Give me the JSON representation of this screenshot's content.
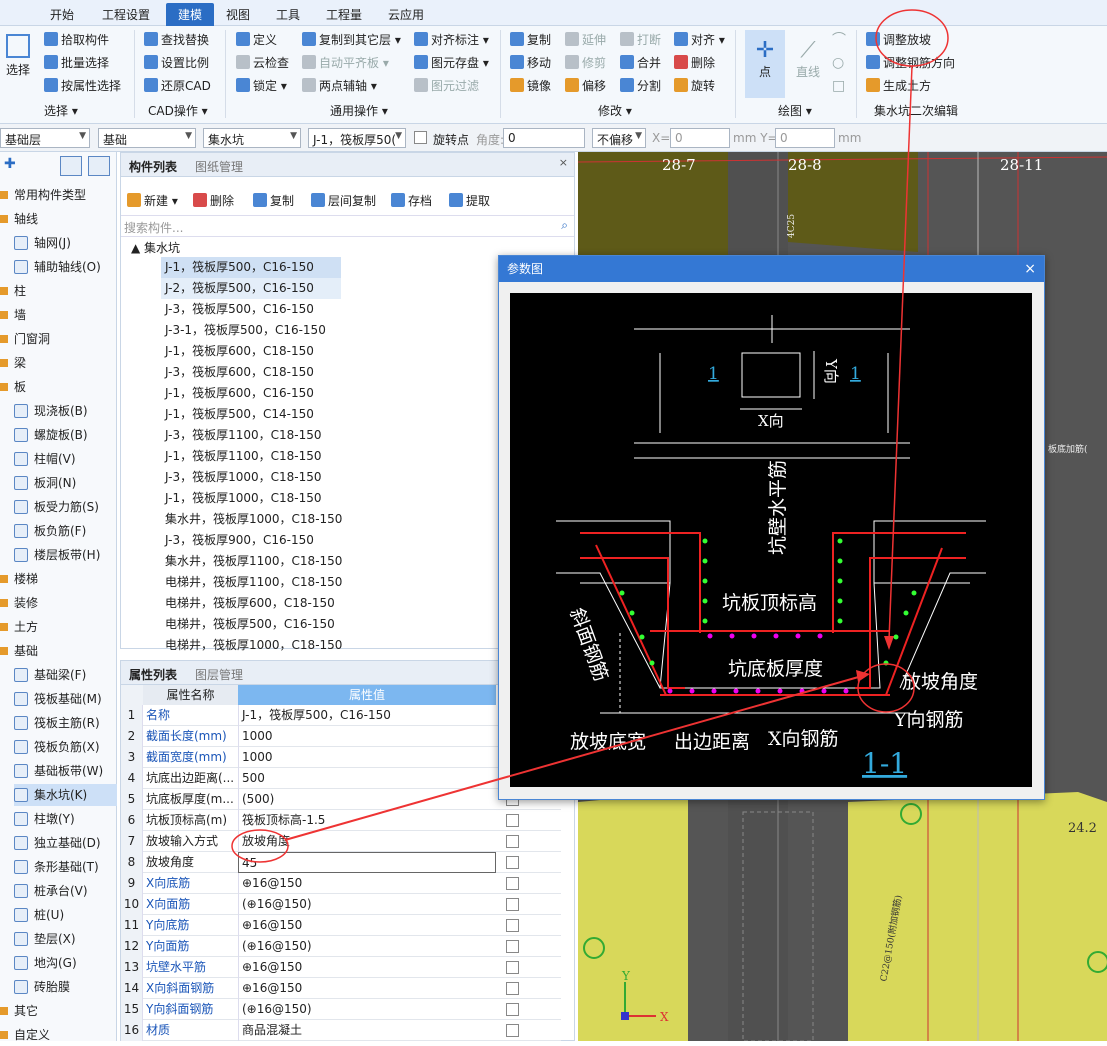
{
  "ribbon_tabs": [
    "开始",
    "工程设置",
    "建模",
    "视图",
    "工具",
    "工程量",
    "云应用"
  ],
  "select_group": {
    "select": "选择",
    "pick": "拾取构件",
    "batch": "批量选择",
    "by_prop": "按属性选择",
    "label": "选择 ▾"
  },
  "cad_group": {
    "find": "查找替换",
    "scale": "设置比例",
    "restore": "还原CAD",
    "label": "CAD操作 ▾"
  },
  "common_group": {
    "define": "定义",
    "cloud": "云检查",
    "lock": "锁定 ▾",
    "copy_to": "复制到其它层 ▾",
    "auto_level": "自动平齐板 ▾",
    "two_point": "两点辅轴 ▾",
    "align_label": "对齐标注 ▾",
    "elem_store": "图元存盘 ▾",
    "elem_filter": "图元过滤",
    "label": "通用操作 ▾"
  },
  "modify_group": {
    "copy": "复制",
    "move": "移动",
    "mirror": "镜像",
    "extend": "延伸",
    "trim": "修剪",
    "offset": "偏移",
    "break": "打断",
    "merge": "合并",
    "split": "分割",
    "align": "对齐 ▾",
    "delete": "删除",
    "rotate": "旋转",
    "label": "修改 ▾"
  },
  "draw_group": {
    "point": "点",
    "line": "直线",
    "label": "绘图 ▾"
  },
  "pit_group": {
    "adjust_slope": "调整放坡",
    "adjust_rebar": "调整钢筋方向",
    "gen_earth": "生成土方",
    "label": "集水坑二次编辑"
  },
  "options": {
    "floor": "基础层",
    "category": "基础",
    "type": "集水坑",
    "component": "J-1，筏板厚50(",
    "rotate_point": "旋转点",
    "angle_label": "角度:",
    "angle": "0",
    "offset": "不偏移",
    "x_label": "X=",
    "x": "0",
    "y_label": "mm Y=",
    "y": "0",
    "unit": "mm"
  },
  "nav": {
    "items": [
      {
        "t": "常用构件类型",
        "sub": false
      },
      {
        "t": "轴线",
        "sub": false
      },
      {
        "t": "轴网(J)",
        "sub": true
      },
      {
        "t": "辅助轴线(O)",
        "sub": true
      },
      {
        "t": "柱",
        "sub": false
      },
      {
        "t": "墙",
        "sub": false
      },
      {
        "t": "门窗洞",
        "sub": false
      },
      {
        "t": "梁",
        "sub": false
      },
      {
        "t": "板",
        "sub": false
      },
      {
        "t": "现浇板(B)",
        "sub": true
      },
      {
        "t": "螺旋板(B)",
        "sub": true
      },
      {
        "t": "柱帽(V)",
        "sub": true
      },
      {
        "t": "板洞(N)",
        "sub": true
      },
      {
        "t": "板受力筋(S)",
        "sub": true
      },
      {
        "t": "板负筋(F)",
        "sub": true
      },
      {
        "t": "楼层板带(H)",
        "sub": true
      },
      {
        "t": "楼梯",
        "sub": false
      },
      {
        "t": "装修",
        "sub": false
      },
      {
        "t": "土方",
        "sub": false
      },
      {
        "t": "基础",
        "sub": false
      },
      {
        "t": "基础梁(F)",
        "sub": true
      },
      {
        "t": "筏板基础(M)",
        "sub": true
      },
      {
        "t": "筏板主筋(R)",
        "sub": true
      },
      {
        "t": "筏板负筋(X)",
        "sub": true
      },
      {
        "t": "基础板带(W)",
        "sub": true
      },
      {
        "t": "集水坑(K)",
        "sub": true,
        "sel": true
      },
      {
        "t": "柱墩(Y)",
        "sub": true
      },
      {
        "t": "独立基础(D)",
        "sub": true
      },
      {
        "t": "条形基础(T)",
        "sub": true
      },
      {
        "t": "桩承台(V)",
        "sub": true
      },
      {
        "t": "桩(U)",
        "sub": true
      },
      {
        "t": "垫层(X)",
        "sub": true
      },
      {
        "t": "地沟(G)",
        "sub": true
      },
      {
        "t": "砖胎膜",
        "sub": true
      },
      {
        "t": "其它",
        "sub": false
      },
      {
        "t": "自定义",
        "sub": false
      }
    ]
  },
  "comp_panel": {
    "tab1": "构件列表",
    "tab2": "图纸管理",
    "new": "新建 ▾",
    "delete": "删除",
    "copy": "复制",
    "floor_copy": "层间复制",
    "save": "存档",
    "extract": "提取",
    "search": "搜索构件...",
    "root": "集水坑",
    "items": [
      "J-1，筏板厚500，C16-150",
      "J-2，筏板厚500，C16-150",
      "J-3，筏板厚500，C16-150",
      "J-3-1，筏板厚500，C16-150",
      "J-1，筏板厚600，C18-150",
      "J-3，筏板厚600，C18-150",
      "J-1，筏板厚600，C16-150",
      "J-1，筏板厚500，C14-150",
      "J-3，筏板厚1100，C18-150",
      "J-1，筏板厚1100，C18-150",
      "J-3，筏板厚1000，C18-150",
      "J-1，筏板厚1000，C18-150",
      "集水井，筏板厚1000，C18-150",
      "J-3，筏板厚900，C16-150",
      "集水井，筏板厚1100，C18-150",
      "电梯井，筏板厚1100，C18-150",
      "电梯井，筏板厚600，C18-150",
      "电梯井，筏板厚500，C16-150",
      "电梯井，筏板厚1000，C18-150"
    ]
  },
  "prop_panel": {
    "tab1": "属性列表",
    "tab2": "图层管理",
    "h_name": "属性名称",
    "h_value": "属性值",
    "rows": [
      {
        "n": "1",
        "k": "名称",
        "v": "J-1，筏板厚500，C16-150",
        "blue": true
      },
      {
        "n": "2",
        "k": "截面长度(mm)",
        "v": "1000",
        "blue": true
      },
      {
        "n": "3",
        "k": "截面宽度(mm)",
        "v": "1000",
        "blue": true
      },
      {
        "n": "4",
        "k": "坑底出边距离(...",
        "v": "500",
        "blue": false
      },
      {
        "n": "5",
        "k": "坑底板厚度(m...",
        "v": "(500)",
        "blue": false
      },
      {
        "n": "6",
        "k": "坑板顶标高(m)",
        "v": "筏板顶标高-1.5",
        "blue": false
      },
      {
        "n": "7",
        "k": "放坡输入方式",
        "v": "放坡角度",
        "blue": false
      },
      {
        "n": "8",
        "k": "放坡角度",
        "v": "45",
        "blue": false
      },
      {
        "n": "9",
        "k": "X向底筋",
        "v": "⊕16@150",
        "blue": true
      },
      {
        "n": "10",
        "k": "X向面筋",
        "v": "(⊕16@150)",
        "blue": true
      },
      {
        "n": "11",
        "k": "Y向底筋",
        "v": "⊕16@150",
        "blue": true
      },
      {
        "n": "12",
        "k": "Y向面筋",
        "v": "(⊕16@150)",
        "blue": true
      },
      {
        "n": "13",
        "k": "坑壁水平筋",
        "v": "⊕16@150",
        "blue": true
      },
      {
        "n": "14",
        "k": "X向斜面钢筋",
        "v": "⊕16@150",
        "blue": true
      },
      {
        "n": "15",
        "k": "Y向斜面钢筋",
        "v": "(⊕16@150)",
        "blue": true
      },
      {
        "n": "16",
        "k": "材质",
        "v": "商品混凝土",
        "blue": true
      }
    ]
  },
  "canvas": {
    "axis1": "28-7",
    "axis2": "28-8",
    "axis3": "28-11",
    "rebar1": "4C25",
    "rebar2": "C22@150(附加钢筋)",
    "label3": "24.2",
    "label4": "板底加筋(",
    "x_axis": "X",
    "y_axis": "Y"
  },
  "dialog": {
    "title": "参数图",
    "close": "×",
    "labels": {
      "sec1": "1",
      "sec2": "1",
      "x_dir": "X向",
      "y_dir": "Y向",
      "wall_rebar": "坑壁水平筋",
      "top_elev": "坑板顶标高",
      "slope_rebar": "斜面钢筋",
      "bottom_thick": "坑底板厚度",
      "slope_angle": "放坡角度",
      "y_rebar": "Y向钢筋",
      "slope_width": "放坡底宽",
      "edge_dist": "出边距离",
      "x_rebar": "X向钢筋",
      "section": "1-1"
    }
  }
}
